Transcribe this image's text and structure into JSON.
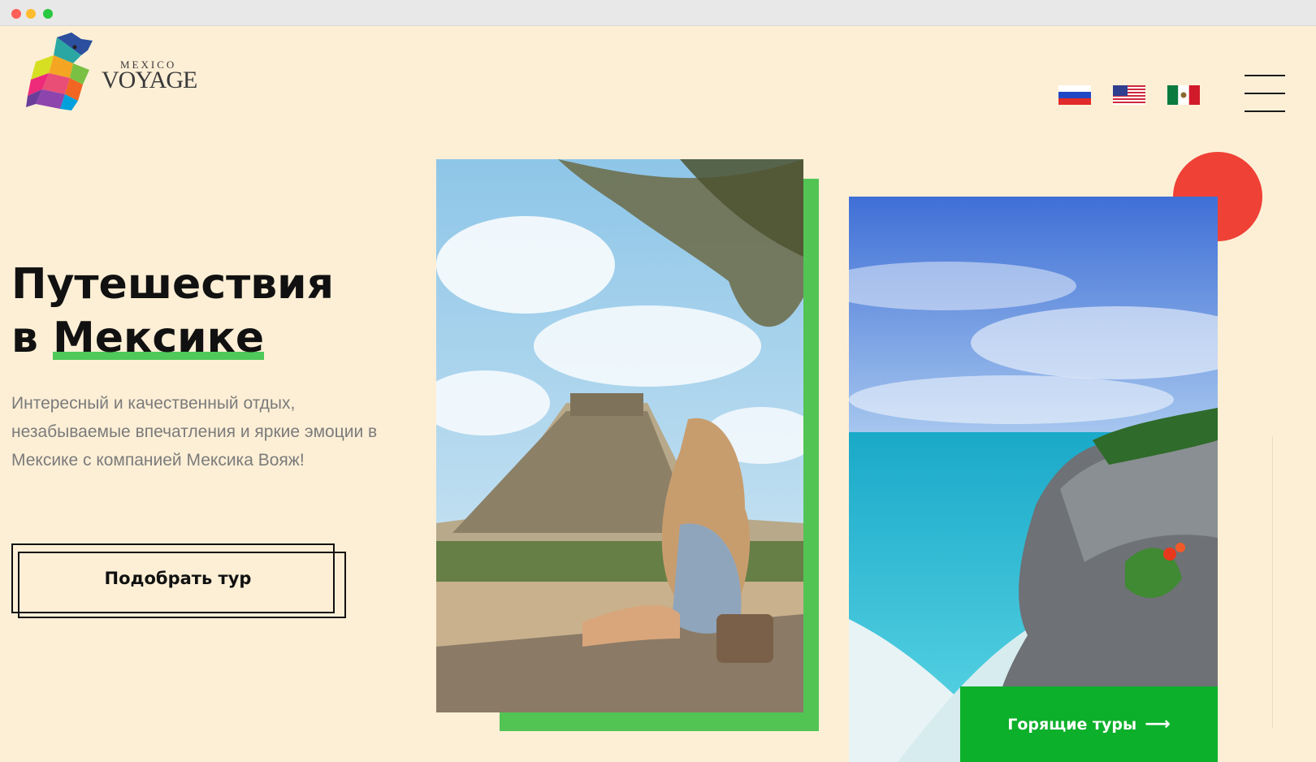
{
  "window": {
    "controls": [
      "close",
      "minimize",
      "maximize"
    ]
  },
  "header": {
    "logo_small": "MEXICO",
    "logo_big": "VOYAGE",
    "languages": [
      {
        "code": "ru",
        "icon": "russia-flag-icon"
      },
      {
        "code": "en",
        "icon": "usa-flag-icon"
      },
      {
        "code": "es",
        "icon": "mexico-flag-icon"
      }
    ],
    "menu_icon": "hamburger-menu-icon"
  },
  "hero": {
    "title_line1": "Путешествия",
    "title_line2_prefix": "в",
    "title_line2_highlight": "Мексике",
    "description": "Интересный и качественный отдых, незабываемые впечатления и яркие эмоции в Мексике с компанией Мексика Вояж!",
    "cta_label": "Подобрать тур"
  },
  "gallery": {
    "image1": "pyramid-photo",
    "image2": "beach-photo",
    "hot_tours_label": "Горящие туры",
    "hot_tours_icon": "arrow-right-icon"
  },
  "colors": {
    "background": "#fdefd6",
    "accent_green": "#52c454",
    "button_green": "#0cb02a",
    "accent_red": "#ef4136",
    "text_dark": "#111111",
    "text_muted": "#7b7b7b"
  }
}
